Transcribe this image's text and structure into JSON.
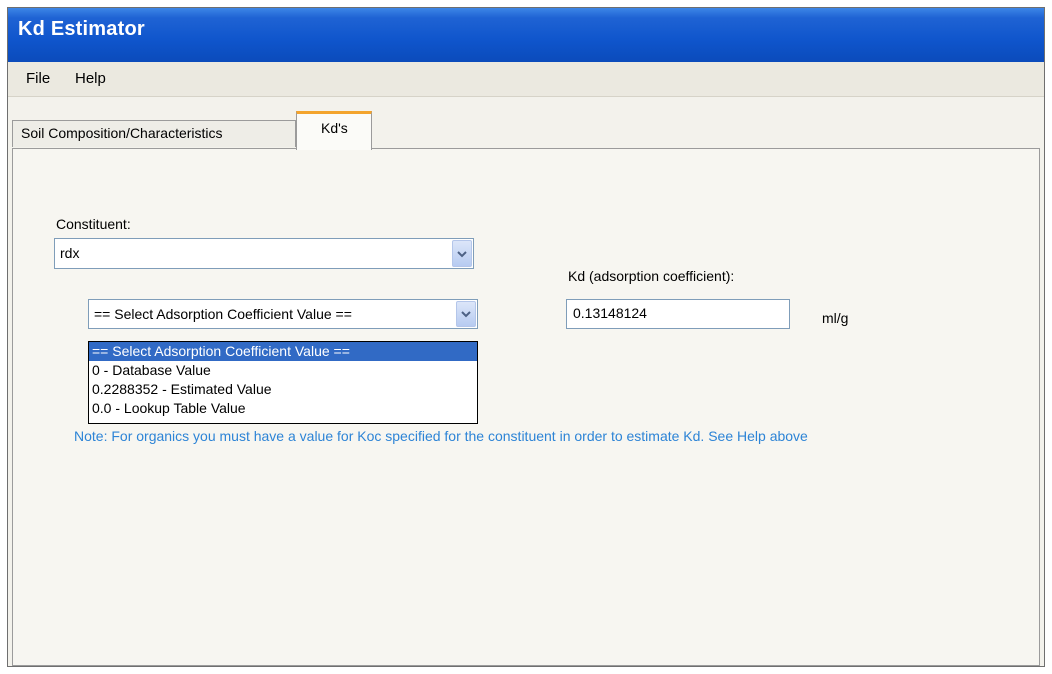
{
  "window": {
    "title": "Kd Estimator"
  },
  "menu": {
    "items": [
      "File",
      "Help"
    ]
  },
  "tabs": [
    {
      "label": "Soil Composition/Characteristics",
      "active": false
    },
    {
      "label": "Kd's",
      "active": true
    }
  ],
  "constituent": {
    "label": "Constituent:",
    "value": "rdx"
  },
  "adsorption_select": {
    "value": "== Select Adsorption Coefficient Value ==",
    "options": [
      "== Select Adsorption Coefficient Value ==",
      "0  - Database Value",
      "0.2288352  - Estimated Value",
      "0.0  - Lookup Table Value"
    ],
    "selected_index": 0
  },
  "kd": {
    "label": "Kd (adsorption coefficient):",
    "value": "0.13148124",
    "unit": "ml/g"
  },
  "note": "Note: For organics you must have a value for Koc specified for the constituent in order to estimate Kd.  See Help above",
  "colors": {
    "titlebar": "#0f55cc",
    "note_text": "#2d84d6",
    "selection": "#316ac5",
    "active_tab_accent": "#f3a42e"
  }
}
